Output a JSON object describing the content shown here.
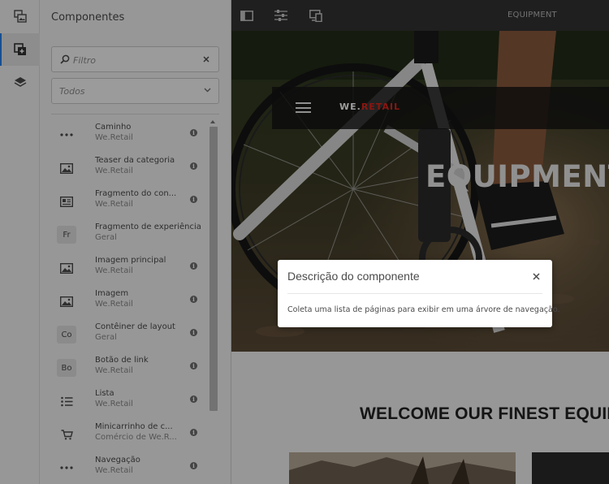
{
  "panel": {
    "title": "Componentes",
    "search": {
      "placeholder": "Filtro",
      "value": ""
    },
    "group_filter": {
      "selected": "Todos"
    },
    "items": [
      {
        "name": "Caminho",
        "group": "We.Retail",
        "icon": "more-dots-icon"
      },
      {
        "name": "Teaser da categoria",
        "group": "We.Retail",
        "icon": "image-icon"
      },
      {
        "name": "Fragmento do con...",
        "group": "We.Retail",
        "icon": "content-fragment-icon"
      },
      {
        "name": "Fragmento de experiência",
        "group": "Geral",
        "icon": "abbreviation-box-icon",
        "abbr": "Fr"
      },
      {
        "name": "Imagem principal",
        "group": "We.Retail",
        "icon": "image-icon"
      },
      {
        "name": "Imagem",
        "group": "We.Retail",
        "icon": "image-icon"
      },
      {
        "name": "Contêiner de layout",
        "group": "Geral",
        "icon": "abbreviation-box-icon",
        "abbr": "Co"
      },
      {
        "name": "Botão de link",
        "group": "We.Retail",
        "icon": "abbreviation-box-icon",
        "abbr": "Bo"
      },
      {
        "name": "Lista",
        "group": "We.Retail",
        "icon": "list-icon"
      },
      {
        "name": "Minicarrinho de c...",
        "group": "Comércio de We.R...",
        "icon": "cart-icon"
      },
      {
        "name": "Navegação",
        "group": "We.Retail",
        "icon": "more-dots-icon"
      }
    ]
  },
  "toolbar": {
    "page_name": "EQUIPMENT"
  },
  "page": {
    "brand_prefix": "WE.",
    "brand_accent": "RETAIL",
    "hero_heading": "EQUIPMENT",
    "welcome_heading": "WELCOME OUR FINEST EQUIPMENT"
  },
  "popover": {
    "title": "Descrição do componente",
    "body": "Coleta uma lista de páginas para exibir em uma árvore de navegação."
  },
  "colors": {
    "accent": "#2680eb",
    "brand_red": "#e1251b",
    "toolbar": "#323232"
  }
}
